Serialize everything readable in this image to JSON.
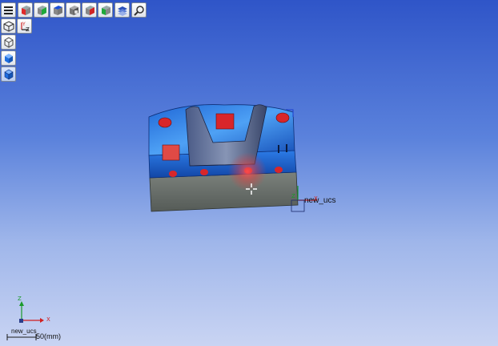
{
  "toolbar": {
    "icons": [
      "menu-icon",
      "view-cube-red-icon",
      "view-cube-green-icon",
      "view-cube-blue-icon",
      "view-cube-wire-icon",
      "view-cube-red-2-icon",
      "view-cube-green-2-icon",
      "layers-icon",
      "zoom-fit-icon"
    ],
    "sidebar_icons": [
      "iso-view-icon",
      "axis-xyz-icon",
      "wireframe-cube-icon",
      "shaded-cube-icon",
      "shaded-cube-selected-icon"
    ]
  },
  "axis_labels": {
    "top_y": "Y",
    "top_z": "Z",
    "x": "X",
    "z": "Z"
  },
  "model_ucs_label": "new_ucs",
  "corner_ucs_label": "new_ucs",
  "scale_label": "50(mm)",
  "colors": {
    "background_top": "#2f55c8",
    "background_bottom": "#c9d4f3",
    "part_blue": "#1f6fd8",
    "part_gray": "#6d7470",
    "feature_red": "#d8262a"
  }
}
